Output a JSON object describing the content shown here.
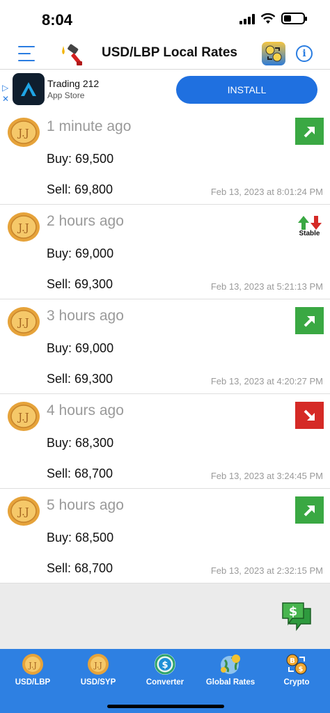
{
  "status_bar": {
    "time": "8:04"
  },
  "header": {
    "title": "USD/LBP Local Rates",
    "menu_icon": "hamburger-menu-icon",
    "fuel_icon": "fuel-pump-icon",
    "exchange_icon": "currency-exchange-icon",
    "info_icon": "info-icon",
    "accent_color": "#2a7de1"
  },
  "ad": {
    "app_name": "Trading 212",
    "store": "App Store",
    "button": "INSTALL",
    "button_color": "#1f70e0"
  },
  "rates": [
    {
      "time_ago": "1 minute ago",
      "buy": "Buy: 69,500",
      "sell": "Sell: 69,800",
      "timestamp": "Feb 13, 2023 at 8:01:24 PM",
      "trend": "up"
    },
    {
      "time_ago": "2 hours ago",
      "buy": "Buy: 69,000",
      "sell": "Sell: 69,300",
      "timestamp": "Feb 13, 2023 at 5:21:13 PM",
      "trend": "stable",
      "trend_label": "Stable"
    },
    {
      "time_ago": "3 hours ago",
      "buy": "Buy: 69,000",
      "sell": "Sell: 69,300",
      "timestamp": "Feb 13, 2023 at 4:20:27 PM",
      "trend": "up"
    },
    {
      "time_ago": "4 hours ago",
      "buy": "Buy: 68,300",
      "sell": "Sell: 68,700",
      "timestamp": "Feb 13, 2023 at 3:24:45 PM",
      "trend": "down"
    },
    {
      "time_ago": "5 hours ago",
      "buy": "Buy: 68,500",
      "sell": "Sell: 68,700",
      "timestamp": "Feb 13, 2023 at 2:32:15 PM",
      "trend": "up"
    }
  ],
  "colors": {
    "up": "#3aa843",
    "down": "#d52a26",
    "tabbar": "#2e80e2"
  },
  "tabs": [
    {
      "label": "USD/LBP",
      "icon": "coin-icon"
    },
    {
      "label": "USD/SYP",
      "icon": "coin-icon"
    },
    {
      "label": "Converter",
      "icon": "dollar-converter-icon"
    },
    {
      "label": "Global Rates",
      "icon": "globe-icon"
    },
    {
      "label": "Crypto",
      "icon": "bitcoin-exchange-icon"
    }
  ],
  "fab_icon": "dollar-chat-icon"
}
